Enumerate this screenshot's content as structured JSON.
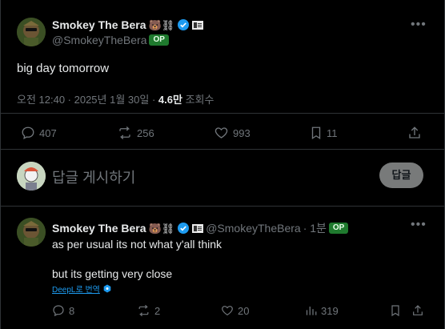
{
  "main_tweet": {
    "display_name": "Smokey The Bera",
    "name_emojis": "🐻⛓",
    "handle": "@SmokeyTheBera",
    "op_badge": "OP",
    "text": "big day tomorrow",
    "timestamp": "오전 12:40 · 2025년 1월 30일 · ",
    "views_count": "4.6만",
    "views_label": "조회수",
    "actions": {
      "replies": "407",
      "reposts": "256",
      "likes": "993",
      "bookmarks": "11"
    }
  },
  "composer": {
    "placeholder": "답글 게시하기",
    "button_label": "답글"
  },
  "reply_tweet": {
    "display_name": "Smokey The Bera",
    "name_emojis": "🐻⛓",
    "handle": "@SmokeyTheBera",
    "time": "· 1분",
    "op_badge": "OP",
    "line1": "as per usual its not what y'all think",
    "line2": "but its getting very close",
    "translate_label": "DeepL로 번역",
    "actions": {
      "replies": "8",
      "reposts": "2",
      "likes": "20",
      "views": "319"
    }
  },
  "colors": {
    "background": "#000000",
    "text": "#e7e9ea",
    "muted": "#71767b",
    "verified": "#1d9bf0",
    "op_badge": "#1f7a2e"
  }
}
